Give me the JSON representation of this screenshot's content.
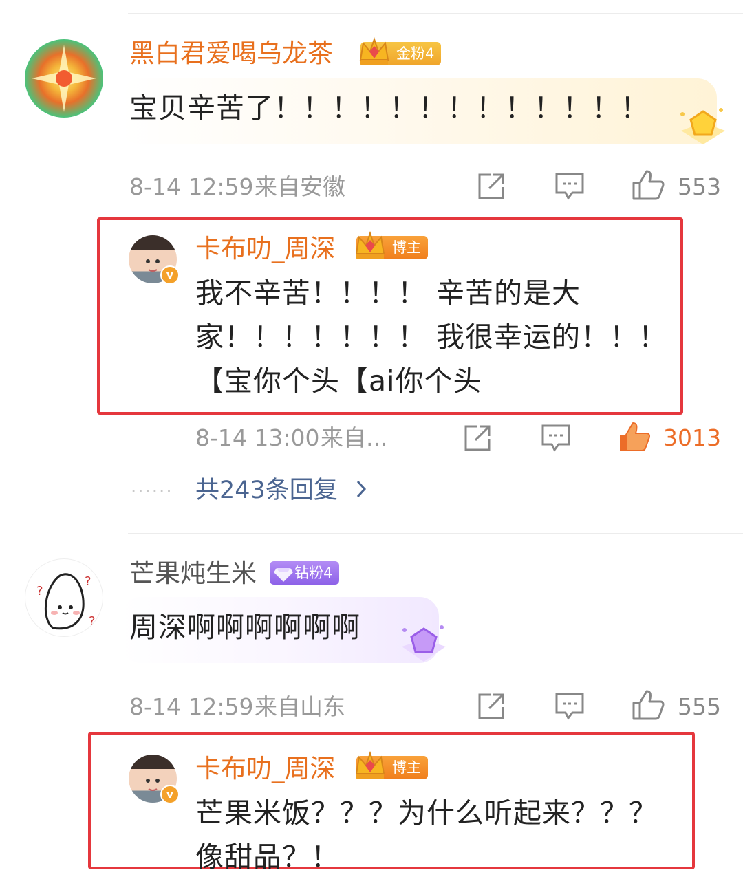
{
  "comments": [
    {
      "username": "黑白君爱喝乌龙茶",
      "badge": "金粉4",
      "text": "宝贝辛苦了！！！！！！！！！！！！！",
      "time": "8-14 12:59",
      "location": "来自安徽",
      "likes": "553",
      "reply": {
        "username": "卡布叻_周深",
        "badge": "博主",
        "lines": [
          "我不辛苦！！！！ 辛苦的是大",
          "家！！！！！！！ 我很幸运的！！！",
          "【宝你个头【ai你个头"
        ],
        "time": "8-14 13:00",
        "location": "来自...",
        "likes": "3013"
      },
      "more_replies": "共243条回复"
    },
    {
      "username": "芒果炖生米",
      "badge": "钻粉4",
      "text": "周深啊啊啊啊啊啊",
      "time": "8-14 12:59",
      "location": "来自山东",
      "likes": "555",
      "reply": {
        "username": "卡布叻_周深",
        "badge": "博主",
        "lines": [
          "芒果米饭？？？为什么听起来？？？",
          "像甜品？！"
        ]
      }
    }
  ],
  "icons": {
    "share": "share-icon",
    "comment": "comment-icon",
    "like": "thumbs-up-icon",
    "verified": "verified-v-icon",
    "crown": "crown-icon",
    "diamond": "diamond-icon"
  },
  "colors": {
    "username_gold": "#e8701e",
    "highlight_border": "#e5373d",
    "link_blue": "#4b6591",
    "like_active": "#ec6d28"
  }
}
